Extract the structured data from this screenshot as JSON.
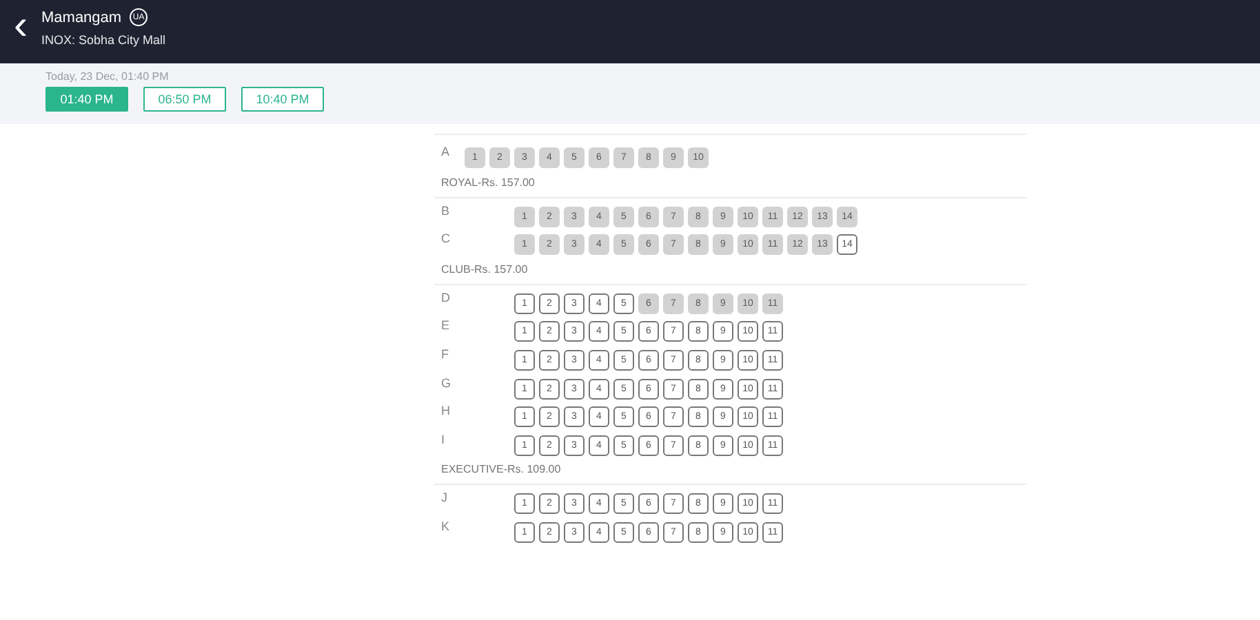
{
  "header": {
    "back_icon": "‹",
    "movie_title": "Mamangam",
    "certificate": "UA",
    "venue": "INOX: Sobha City Mall"
  },
  "showtimes": {
    "date_label": "Today, 23 Dec, 01:40 PM",
    "times": [
      {
        "label": "01:40 PM",
        "selected": true
      },
      {
        "label": "06:50 PM",
        "selected": false
      },
      {
        "label": "10:40 PM",
        "selected": false
      }
    ]
  },
  "sections": [
    {
      "rows": [
        {
          "label": "A",
          "kind": "near",
          "seats": [
            {
              "number": "1",
              "booked": true
            },
            {
              "number": "2",
              "booked": true
            },
            {
              "number": "3",
              "booked": true
            },
            {
              "number": "4",
              "booked": true
            },
            {
              "number": "5",
              "booked": true
            },
            {
              "number": "6",
              "booked": true
            },
            {
              "number": "7",
              "booked": true
            },
            {
              "number": "8",
              "booked": true
            },
            {
              "number": "9",
              "booked": true
            },
            {
              "number": "10",
              "booked": true
            }
          ]
        }
      ]
    },
    {
      "title": "ROYAL-Rs. 157.00",
      "rows": [
        {
          "label": "B",
          "kind": "indented",
          "seats": [
            {
              "number": "1",
              "booked": true
            },
            {
              "number": "2",
              "booked": true
            },
            {
              "number": "3",
              "booked": true
            },
            {
              "number": "4",
              "booked": true
            },
            {
              "number": "5",
              "booked": true
            },
            {
              "number": "6",
              "booked": true
            },
            {
              "number": "7",
              "booked": true
            },
            {
              "number": "8",
              "booked": true
            },
            {
              "number": "9",
              "booked": true
            },
            {
              "number": "10",
              "booked": true
            },
            {
              "number": "11",
              "booked": true
            },
            {
              "number": "12",
              "booked": true
            },
            {
              "number": "13",
              "booked": true
            },
            {
              "number": "14",
              "booked": true
            }
          ]
        },
        {
          "label": "C",
          "kind": "indented",
          "seats": [
            {
              "number": "1",
              "booked": true
            },
            {
              "number": "2",
              "booked": true
            },
            {
              "number": "3",
              "booked": true
            },
            {
              "number": "4",
              "booked": true
            },
            {
              "number": "5",
              "booked": true
            },
            {
              "number": "6",
              "booked": true
            },
            {
              "number": "7",
              "booked": true
            },
            {
              "number": "8",
              "booked": true
            },
            {
              "number": "9",
              "booked": true
            },
            {
              "number": "10",
              "booked": true
            },
            {
              "number": "11",
              "booked": true
            },
            {
              "number": "12",
              "booked": true
            },
            {
              "number": "13",
              "booked": true
            },
            {
              "number": "14",
              "booked": false
            }
          ]
        }
      ]
    },
    {
      "title": "CLUB-Rs. 157.00",
      "rows": [
        {
          "label": "D",
          "kind": "indented",
          "seats": [
            {
              "number": "1",
              "booked": false
            },
            {
              "number": "2",
              "booked": false
            },
            {
              "number": "3",
              "booked": false
            },
            {
              "number": "4",
              "booked": false
            },
            {
              "number": "5",
              "booked": false
            },
            {
              "number": "6",
              "booked": true
            },
            {
              "number": "7",
              "booked": true
            },
            {
              "number": "8",
              "booked": true
            },
            {
              "number": "9",
              "booked": true
            },
            {
              "number": "10",
              "booked": true
            },
            {
              "number": "11",
              "booked": true
            }
          ]
        },
        {
          "label": "E",
          "kind": "indented",
          "seats": [
            {
              "number": "1",
              "booked": false
            },
            {
              "number": "2",
              "booked": false
            },
            {
              "number": "3",
              "booked": false
            },
            {
              "number": "4",
              "booked": false
            },
            {
              "number": "5",
              "booked": false
            },
            {
              "number": "6",
              "booked": false
            },
            {
              "number": "7",
              "booked": false
            },
            {
              "number": "8",
              "booked": false
            },
            {
              "number": "9",
              "booked": false
            },
            {
              "number": "10",
              "booked": false
            },
            {
              "number": "11",
              "booked": false
            }
          ]
        },
        {
          "label": "F",
          "kind": "indented",
          "seats": [
            {
              "number": "1",
              "booked": false
            },
            {
              "number": "2",
              "booked": false
            },
            {
              "number": "3",
              "booked": false
            },
            {
              "number": "4",
              "booked": false
            },
            {
              "number": "5",
              "booked": false
            },
            {
              "number": "6",
              "booked": false
            },
            {
              "number": "7",
              "booked": false
            },
            {
              "number": "8",
              "booked": false
            },
            {
              "number": "9",
              "booked": false
            },
            {
              "number": "10",
              "booked": false
            },
            {
              "number": "11",
              "booked": false
            }
          ]
        },
        {
          "label": "G",
          "kind": "indented",
          "seats": [
            {
              "number": "1",
              "booked": false
            },
            {
              "number": "2",
              "booked": false
            },
            {
              "number": "3",
              "booked": false
            },
            {
              "number": "4",
              "booked": false
            },
            {
              "number": "5",
              "booked": false
            },
            {
              "number": "6",
              "booked": false
            },
            {
              "number": "7",
              "booked": false
            },
            {
              "number": "8",
              "booked": false
            },
            {
              "number": "9",
              "booked": false
            },
            {
              "number": "10",
              "booked": false
            },
            {
              "number": "11",
              "booked": false
            }
          ]
        },
        {
          "label": "H",
          "kind": "indented",
          "seats": [
            {
              "number": "1",
              "booked": false
            },
            {
              "number": "2",
              "booked": false
            },
            {
              "number": "3",
              "booked": false
            },
            {
              "number": "4",
              "booked": false
            },
            {
              "number": "5",
              "booked": false
            },
            {
              "number": "6",
              "booked": false
            },
            {
              "number": "7",
              "booked": false
            },
            {
              "number": "8",
              "booked": false
            },
            {
              "number": "9",
              "booked": false
            },
            {
              "number": "10",
              "booked": false
            },
            {
              "number": "11",
              "booked": false
            }
          ]
        },
        {
          "label": "I",
          "kind": "indented",
          "seats": [
            {
              "number": "1",
              "booked": false
            },
            {
              "number": "2",
              "booked": false
            },
            {
              "number": "3",
              "booked": false
            },
            {
              "number": "4",
              "booked": false
            },
            {
              "number": "5",
              "booked": false
            },
            {
              "number": "6",
              "booked": false
            },
            {
              "number": "7",
              "booked": false
            },
            {
              "number": "8",
              "booked": false
            },
            {
              "number": "9",
              "booked": false
            },
            {
              "number": "10",
              "booked": false
            },
            {
              "number": "11",
              "booked": false
            }
          ]
        }
      ]
    },
    {
      "title": "EXECUTIVE-Rs. 109.00",
      "rows": [
        {
          "label": "J",
          "kind": "indented",
          "seats": [
            {
              "number": "1",
              "booked": false
            },
            {
              "number": "2",
              "booked": false
            },
            {
              "number": "3",
              "booked": false
            },
            {
              "number": "4",
              "booked": false
            },
            {
              "number": "5",
              "booked": false
            },
            {
              "number": "6",
              "booked": false
            },
            {
              "number": "7",
              "booked": false
            },
            {
              "number": "8",
              "booked": false
            },
            {
              "number": "9",
              "booked": false
            },
            {
              "number": "10",
              "booked": false
            },
            {
              "number": "11",
              "booked": false
            }
          ]
        },
        {
          "label": "K",
          "kind": "indented",
          "seats": [
            {
              "number": "1",
              "booked": false
            },
            {
              "number": "2",
              "booked": false
            },
            {
              "number": "3",
              "booked": false
            },
            {
              "number": "4",
              "booked": false
            },
            {
              "number": "5",
              "booked": false
            },
            {
              "number": "6",
              "booked": false
            },
            {
              "number": "7",
              "booked": false
            },
            {
              "number": "8",
              "booked": false
            },
            {
              "number": "9",
              "booked": false
            },
            {
              "number": "10",
              "booked": false
            },
            {
              "number": "11",
              "booked": false
            }
          ]
        }
      ]
    }
  ]
}
